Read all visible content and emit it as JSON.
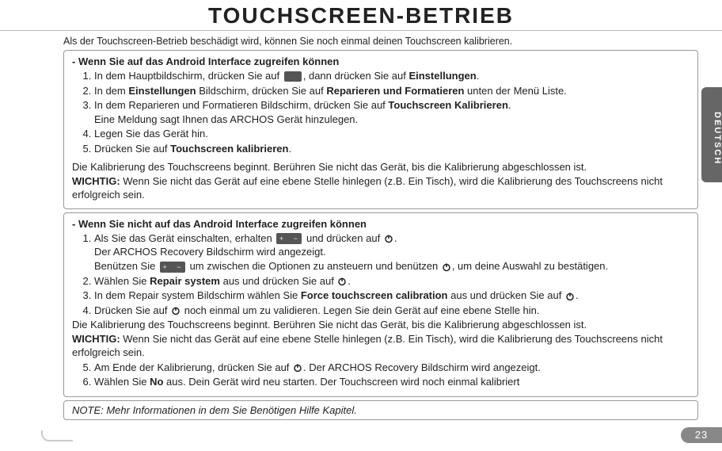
{
  "title": "TOUCHSCREEN-BETRIEB",
  "intro": "Als der Touchscreen-Betrieb beschädigt wird, können Sie noch einmal deinen Touchscreen kalibrieren.",
  "section_a": {
    "heading": "-   Wenn Sie auf das Android Interface zugreifen können",
    "steps": {
      "s1a": "In dem Hauptbildschirm, drücken Sie auf",
      "s1b": ", dann drücken Sie auf ",
      "s1_bold": "Einstellungen",
      "s1c": ".",
      "s2a": "In dem ",
      "s2_bold1": "Einstellungen",
      "s2b": " Bildschirm, drücken Sie auf ",
      "s2_bold2": "Reparieren und Formatieren",
      "s2c": " unten der Menü Liste.",
      "s3a": "In dem Reparieren und Formatieren Bildschirm, drücken Sie auf ",
      "s3_bold": "Touchscreen Kalibrieren",
      "s3b": ".",
      "s3_sub": "Eine Meldung sagt Ihnen das ARCHOS Gerät hinzulegen.",
      "s4": "Legen Sie das Gerät hin.",
      "s5a": "Drücken Sie auf ",
      "s5_bold": "Touchscreen kalibrieren",
      "s5b": "."
    },
    "para1": "Die Kalibrierung des Touchscreens beginnt. Berühren Sie nicht das Gerät, bis die Kalibrierung abgeschlossen ist.",
    "wichtig_label": "WICHTIG:",
    "wichtig_text": " Wenn Sie nicht das Gerät auf eine ebene Stelle hinlegen (z.B. Ein Tisch), wird die Kalibrierung des Touchscreens nicht erfolgreich sein."
  },
  "section_b": {
    "heading": "-   Wenn Sie nicht auf das Android Interface zugreifen können",
    "steps": {
      "s1a": "Als Sie das Gerät einschalten, erhalten ",
      "s1b": " und drücken auf ",
      "s1c": ".",
      "s1_sub1": "Der ARCHOS Recovery Bildschirm wird angezeigt.",
      "s1_sub2a": "Benützen Sie ",
      "s1_sub2b": " um zwischen die Optionen zu ansteuern und benützen ",
      "s1_sub2c": ", um deine Auswahl zu bestätigen.",
      "s2a": "Wählen Sie ",
      "s2_bold": "Repair system",
      "s2b": " aus und drücken Sie auf ",
      "s2c": ".",
      "s3a": "In dem Repair system Bildschirm wählen Sie ",
      "s3_bold": "Force touchscreen calibration",
      "s3b": " aus und drücken Sie auf ",
      "s3c": ".",
      "s4a": "Drücken Sie auf ",
      "s4b": " noch einmal um zu validieren. Legen Sie dein Gerät auf eine ebene Stelle hin.",
      "s5a": "Am Ende der Kalibrierung, drücken Sie auf ",
      "s5b": ". Der ARCHOS Recovery Bildschirm wird angezeigt.",
      "s6a": "Wählen Sie ",
      "s6_bold": "No",
      "s6b": " aus. Dein Gerät wird neu starten. Der Touchscreen wird noch einmal kalibriert"
    },
    "para1": "Die Kalibrierung des Touchscreens beginnt. Berühren Sie nicht das Gerät, bis die Kalibrierung abgeschlossen ist.",
    "wichtig_label": "WICHTIG:",
    "wichtig_text": " Wenn Sie nicht das Gerät auf eine ebene Stelle hinlegen (z.B. Ein Tisch), wird die Kalibrierung des Touchscreens nicht erfolgreich sein."
  },
  "note": "NOTE: Mehr Informationen in dem Sie Benötigen Hilfe Kapitel.",
  "side_tab": "DEUTSCH",
  "page_number": "23"
}
